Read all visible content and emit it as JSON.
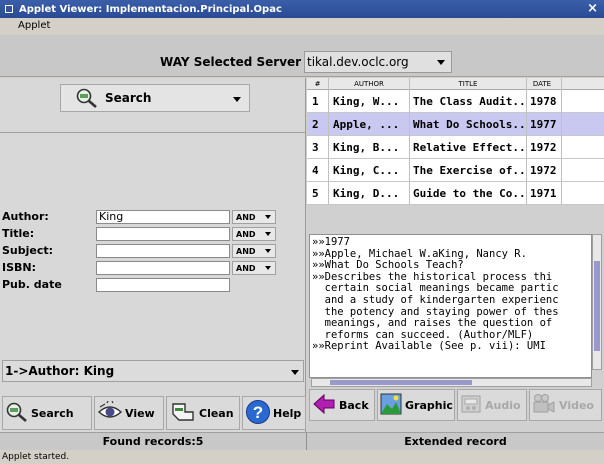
{
  "window": {
    "title": "Applet Viewer: Implementacion.Principal.Opac"
  },
  "menu": {
    "items": [
      "Applet"
    ]
  },
  "server": {
    "label": "WAY Selected Server :",
    "value": "tikal.dev.oclc.org"
  },
  "search_type": {
    "value": "Search"
  },
  "form": {
    "author_label": "Author:",
    "author_value": "King",
    "author_op": "AND",
    "title_label": "Title:",
    "title_value": "",
    "title_op": "AND",
    "subject_label": "Subject:",
    "subject_value": "",
    "subject_op": "AND",
    "isbn_label": "ISBN:",
    "isbn_value": "",
    "isbn_op": "AND",
    "pubdate_label": "Pub. date",
    "pubdate_value": ""
  },
  "history": {
    "value": "1->Author: King"
  },
  "left_buttons": {
    "search": "Search",
    "view": "View",
    "clean": "Clean",
    "help": "Help"
  },
  "results": {
    "headers": [
      "#",
      "AUTHOR",
      "TITLE",
      "DATE"
    ],
    "rows": [
      {
        "num": "1",
        "author": "King, W...",
        "title": "The Class Audit...",
        "date": "1978"
      },
      {
        "num": "2",
        "author": "Apple, ...",
        "title": "What Do Schools...",
        "date": "1977"
      },
      {
        "num": "3",
        "author": "King, B...",
        "title": "Relative Effect...",
        "date": "1972"
      },
      {
        "num": "4",
        "author": "King, C...",
        "title": "The Exercise of...",
        "date": "1972"
      },
      {
        "num": "5",
        "author": "King, D...",
        "title": "Guide to the Co...",
        "date": "1971"
      }
    ]
  },
  "record": {
    "lines": [
      "»»1977",
      "»»Apple, Michael W.aKing, Nancy R.",
      "»»What Do Schools Teach?",
      "»»Describes the historical process thi",
      "  certain social meanings became partic",
      "  and a study of kindergarten experienc",
      "  the potency and staying power of thes",
      "  meanings, and raises the question of",
      "  reforms can succeed. (Author/MLF)",
      "»»Reprint Available (See p. vii): UMI"
    ]
  },
  "right_buttons": {
    "back": "Back",
    "graphic": "Graphic",
    "audio": "Audio",
    "video": "Video"
  },
  "status": {
    "left": "Found records:5",
    "right": "Extended record",
    "applet": "Applet started."
  }
}
